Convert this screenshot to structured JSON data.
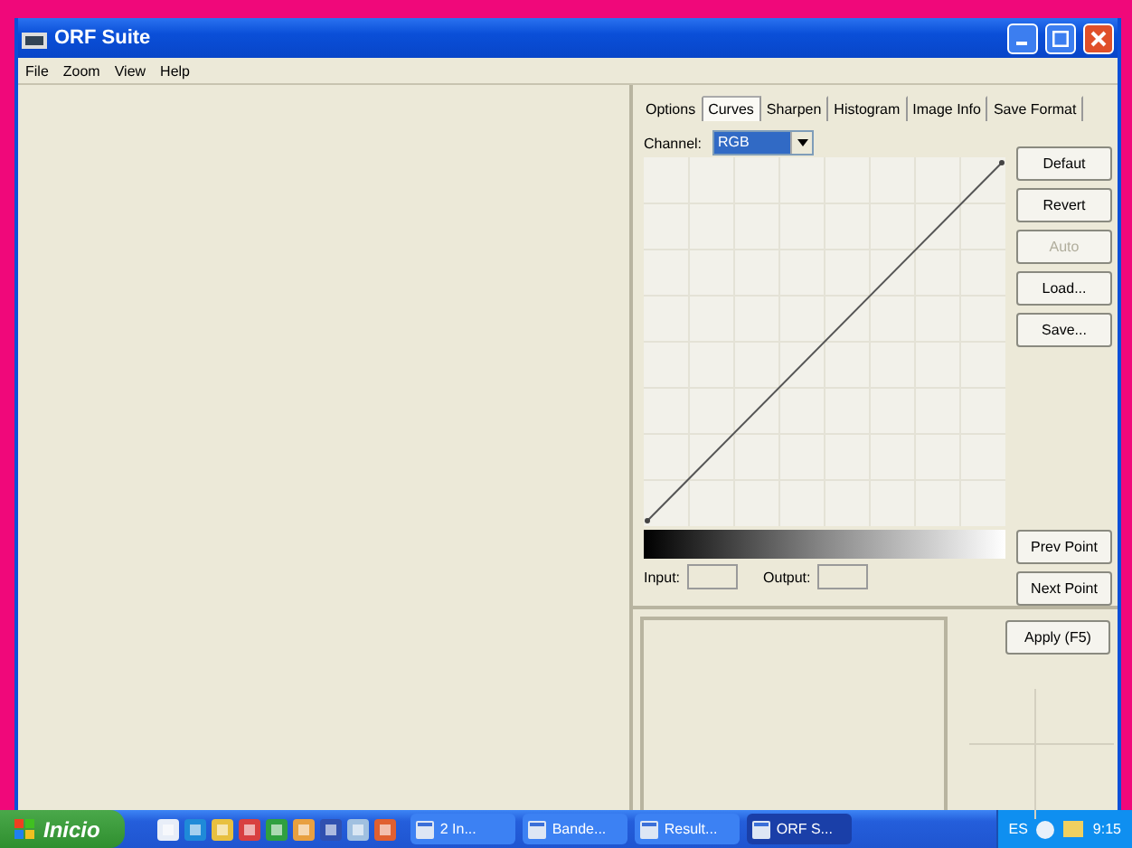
{
  "window": {
    "title": "ORF Suite"
  },
  "menu": [
    "File",
    "Zoom",
    "View",
    "Help"
  ],
  "tabs": [
    {
      "label": "Options",
      "selected": false
    },
    {
      "label": "Curves",
      "selected": true
    },
    {
      "label": "Sharpen",
      "selected": false
    },
    {
      "label": "Histogram",
      "selected": false
    },
    {
      "label": "Image Info",
      "selected": false
    },
    {
      "label": "Save Format",
      "selected": false
    }
  ],
  "channel": {
    "label": "Channel:",
    "value": "RGB"
  },
  "curve_buttons": [
    {
      "label": "Defaut",
      "disabled": false
    },
    {
      "label": "Revert",
      "disabled": false
    },
    {
      "label": "Auto",
      "disabled": true
    },
    {
      "label": "Load...",
      "disabled": false
    },
    {
      "label": "Save...",
      "disabled": false
    }
  ],
  "point_buttons": [
    {
      "label": "Prev Point",
      "disabled": false
    },
    {
      "label": "Next Point",
      "disabled": false
    }
  ],
  "input": {
    "label": "Input:"
  },
  "output": {
    "label": "Output:"
  },
  "apply_button": {
    "label": "Apply (F5)"
  },
  "taskbar": {
    "start": "Inicio",
    "tasks": [
      {
        "label": "2 In...",
        "selected": false
      },
      {
        "label": "Bande...",
        "selected": false
      },
      {
        "label": "Result...",
        "selected": false
      },
      {
        "label": "ORF S...",
        "selected": true
      }
    ],
    "language": "ES",
    "clock": "9:15"
  }
}
